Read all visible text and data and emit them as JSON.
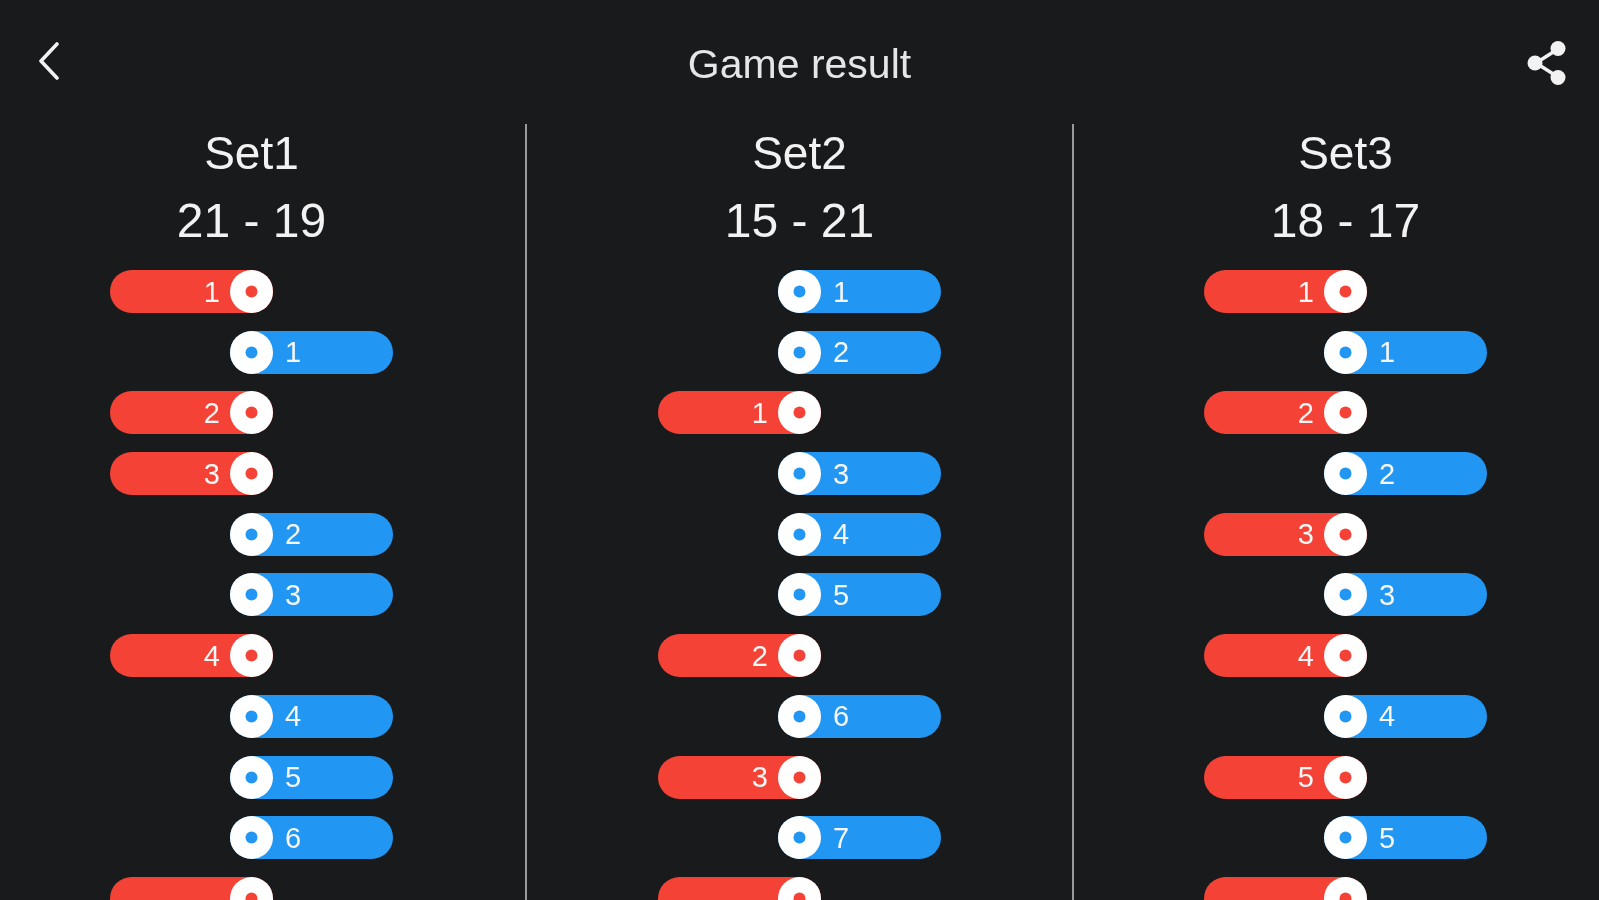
{
  "header": {
    "title": "Game result"
  },
  "sets": [
    {
      "name": "Set1",
      "score": "21 - 19",
      "points": [
        {
          "kind": "home",
          "color": "#f44336",
          "number": "1"
        },
        {
          "kind": "away",
          "color": "#2196f3",
          "number": "1"
        },
        {
          "kind": "home",
          "color": "#f44336",
          "number": "2"
        },
        {
          "kind": "home",
          "color": "#f44336",
          "number": "3"
        },
        {
          "kind": "away",
          "color": "#2196f3",
          "number": "2"
        },
        {
          "kind": "away",
          "color": "#2196f3",
          "number": "3"
        },
        {
          "kind": "home",
          "color": "#f44336",
          "number": "4"
        },
        {
          "kind": "away",
          "color": "#2196f3",
          "number": "4"
        },
        {
          "kind": "away",
          "color": "#2196f3",
          "number": "5"
        },
        {
          "kind": "away",
          "color": "#2196f3",
          "number": "6"
        },
        {
          "kind": "home",
          "color": "#f44336"
        }
      ]
    },
    {
      "name": "Set2",
      "score": "15 - 21",
      "points": [
        {
          "kind": "away",
          "color": "#2196f3",
          "number": "1"
        },
        {
          "kind": "away",
          "color": "#2196f3",
          "number": "2"
        },
        {
          "kind": "home",
          "color": "#f44336",
          "number": "1"
        },
        {
          "kind": "away",
          "color": "#2196f3",
          "number": "3"
        },
        {
          "kind": "away",
          "color": "#2196f3",
          "number": "4"
        },
        {
          "kind": "away",
          "color": "#2196f3",
          "number": "5"
        },
        {
          "kind": "home",
          "color": "#f44336",
          "number": "2"
        },
        {
          "kind": "away",
          "color": "#2196f3",
          "number": "6"
        },
        {
          "kind": "home",
          "color": "#f44336",
          "number": "3"
        },
        {
          "kind": "away",
          "color": "#2196f3",
          "number": "7"
        },
        {
          "kind": "home",
          "color": "#f44336"
        }
      ]
    },
    {
      "name": "Set3",
      "score": "18 - 17",
      "points": [
        {
          "kind": "home",
          "color": "#f44336",
          "number": "1"
        },
        {
          "kind": "away",
          "color": "#2196f3",
          "number": "1"
        },
        {
          "kind": "home",
          "color": "#f44336",
          "number": "2"
        },
        {
          "kind": "away",
          "color": "#2196f3",
          "number": "2"
        },
        {
          "kind": "home",
          "color": "#f44336",
          "number": "3"
        },
        {
          "kind": "away",
          "color": "#2196f3",
          "number": "3"
        },
        {
          "kind": "home",
          "color": "#f44336",
          "number": "4"
        },
        {
          "kind": "away",
          "color": "#2196f3",
          "number": "4"
        },
        {
          "kind": "home",
          "color": "#f44336",
          "number": "5"
        },
        {
          "kind": "away",
          "color": "#2196f3",
          "number": "5"
        },
        {
          "kind": "home",
          "color": "#f44336"
        }
      ]
    }
  ]
}
